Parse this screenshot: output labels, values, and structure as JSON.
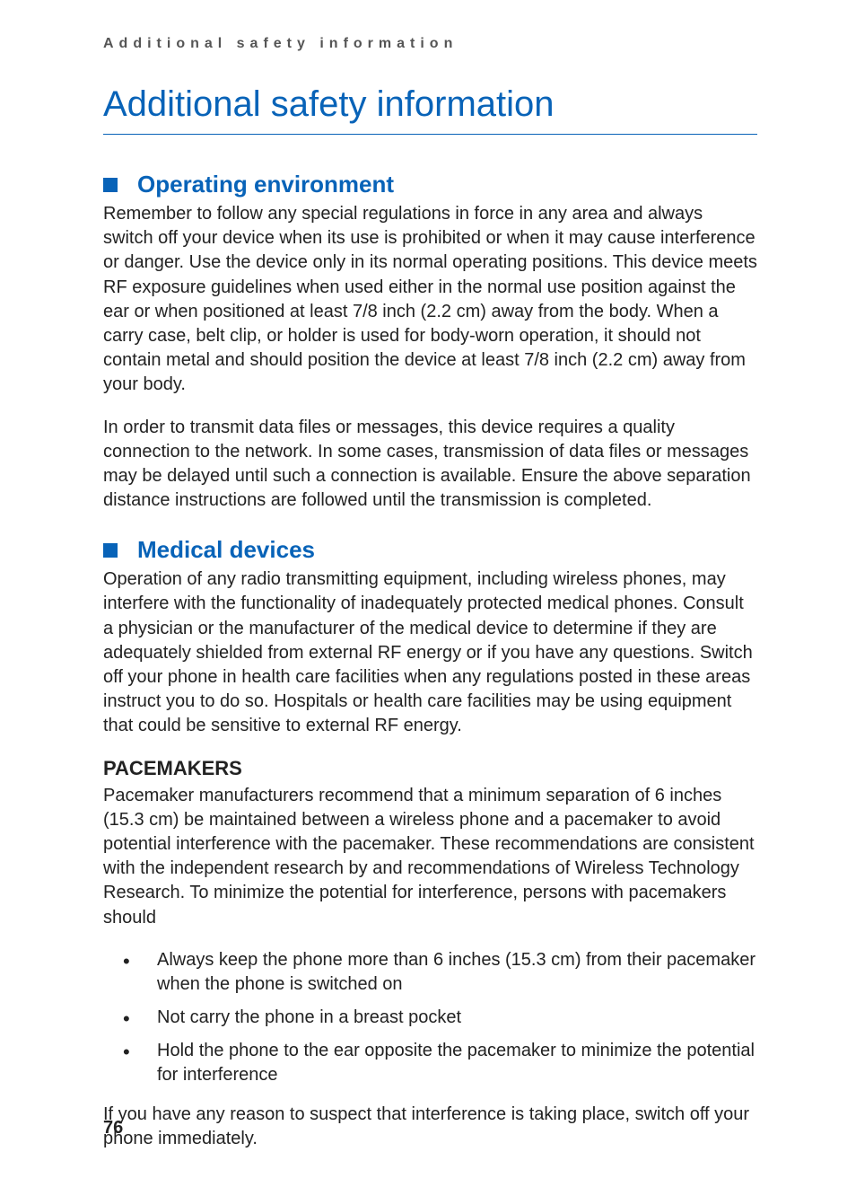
{
  "runningHeader": "Additional safety information",
  "chapterTitle": "Additional safety information",
  "sections": [
    {
      "title": "Operating environment",
      "paragraphs": [
        "Remember to follow any special regulations in force in any area and always switch off your device when its use is prohibited or when it may cause interference or danger. Use the device only in its normal operating positions. This device meets RF exposure guidelines when used either in the normal use position against the ear or when positioned at least 7/8 inch (2.2 cm) away from the body.  When a carry case, belt clip, or holder is used for body-worn operation, it should not contain metal and should position the device at least 7/8 inch (2.2 cm) away from your body.",
        "In order to transmit data files or messages, this device requires a quality connection to the network. In some cases, transmission of data files or messages may be delayed until such a connection is available. Ensure the above separation distance instructions are followed until the transmission is completed."
      ]
    },
    {
      "title": "Medical devices",
      "paragraphs": [
        "Operation of any radio transmitting equipment, including wireless phones, may interfere with the functionality of inadequately protected medical phones. Consult a physician or the manufacturer of the medical device to determine if they are adequately shielded from external RF energy or if you have any questions. Switch off your phone in health care facilities when any regulations posted in these areas instruct you to do so. Hospitals or health care facilities may be using equipment that could be sensitive to external RF energy."
      ],
      "subsection": {
        "title": "PACEMAKERS",
        "intro": "Pacemaker manufacturers recommend that a minimum separation of 6 inches (15.3 cm) be maintained between a wireless phone and a pacemaker to avoid potential interference with the pacemaker. These recommendations are consistent with the independent research by and recommendations of Wireless Technology Research. To minimize the potential for interference, persons with pacemakers should",
        "bullets": [
          "Always keep the phone more than 6 inches (15.3 cm) from their pacemaker when the phone is switched on",
          "Not carry the phone in a breast pocket",
          "Hold the phone to the ear opposite the pacemaker to minimize the potential for interference"
        ],
        "outro": "If you have any reason to suspect that interference is taking place, switch off your phone immediately."
      }
    }
  ],
  "pageNumber": "76"
}
